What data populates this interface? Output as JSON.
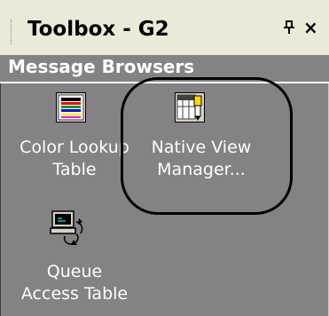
{
  "toolbox": {
    "title": "Toolbox - G2",
    "pin_glyph": "ᵖ",
    "close_glyph": "×"
  },
  "section": {
    "label": "Message Browsers"
  },
  "items": [
    {
      "icon": "color-table-icon",
      "label_line1": "Color Lookup",
      "label_line2": "Table"
    },
    {
      "icon": "view-manager-icon",
      "label_line1": "Native View",
      "label_line2": "Manager..."
    },
    {
      "icon": "queue-computer-icon",
      "label_line1": "Queue",
      "label_line2": "Access Table"
    }
  ],
  "colors": {
    "panel_bg": "#848284",
    "titlebar_bg": "#ece9d8",
    "label_text": "#ffffff"
  }
}
